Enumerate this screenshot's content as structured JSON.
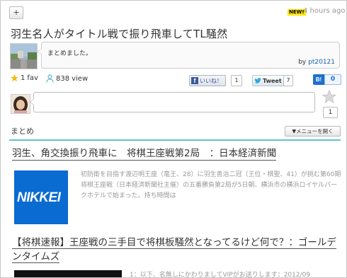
{
  "header": {
    "plus_label": "+",
    "new_badge": "NEW!",
    "time_ago": "4 hours ago"
  },
  "title": "羽生名人がタイトル戦で振り飛車してTL騒然",
  "summary": {
    "comment": "まとめました。",
    "by_prefix": "by",
    "author": "pt20121"
  },
  "stats": {
    "fav_count": "1",
    "fav_label": "fav",
    "view_count": "838",
    "view_label": "view"
  },
  "social": {
    "facebook_label": "いいね！",
    "facebook_count": "1",
    "tweet_label": "Tweet",
    "tweet_count": "7",
    "hatena_label": "B!",
    "hatena_count": "0"
  },
  "favorite": {
    "star_count": "1"
  },
  "section": {
    "heading": "まとめ",
    "menu_button": "▼メニューを開く"
  },
  "items": [
    {
      "link": "羽生、角交換振り飛車に　将棋王座戦第2局　：日本経済新聞",
      "logo_text": "NIKKEI",
      "text": "初防衛を目指す渡辺明王座（竜王、28）に羽生善治二冠（王位・棋聖、41）が挑む第60期将棋王座戦（日本経済新聞社主催）の五番勝負第2局が5日朝、横浜市の横浜ロイヤルパークホテルで始まった。持ち時間は"
    },
    {
      "link": "【将棋速報】王座戦の三手目で将棋板騒然となってるけど何で？：ゴールデンタイムズ",
      "text": "1：以下、名無しにかわりましてVIPがお送りします：2012/09"
    }
  ],
  "colors": {
    "accent_line": "#5fc4cf",
    "nikkei_blue": "#0a6bd1",
    "link_blue": "#1a5fb4",
    "facebook_blue": "#3b5998",
    "hatena_blue": "#1d6fcf"
  }
}
